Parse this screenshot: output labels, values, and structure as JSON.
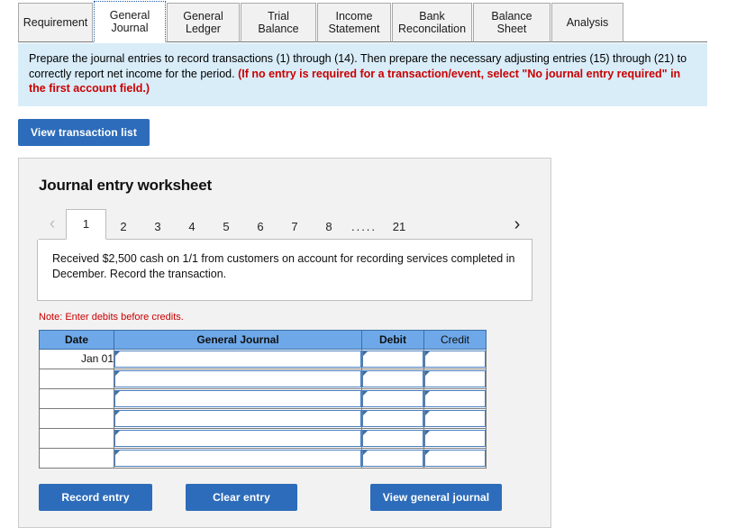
{
  "tabs": [
    {
      "label": "Requirement",
      "active": false
    },
    {
      "label": "General\nJournal",
      "active": true
    },
    {
      "label": "General\nLedger",
      "active": false
    },
    {
      "label": "Trial Balance",
      "active": false
    },
    {
      "label": "Income\nStatement",
      "active": false
    },
    {
      "label": "Bank\nReconcilation",
      "active": false
    },
    {
      "label": "Balance Sheet",
      "active": false
    },
    {
      "label": "Analysis",
      "active": false
    }
  ],
  "instructions": {
    "plain": "Prepare the journal entries to record transactions (1) through (14).  Then prepare the necessary adjusting entries (15) through (21) to correctly report net income for the period. ",
    "warning": "(If no entry is required for a transaction/event, select \"No journal entry required\" in the first account field.)"
  },
  "toolbar": {
    "view_transaction_list": "View transaction list"
  },
  "worksheet": {
    "title": "Journal entry worksheet",
    "pager": {
      "prev_icon": "chevron-left",
      "next_icon": "chevron-right",
      "pages": [
        "1",
        "2",
        "3",
        "4",
        "5",
        "6",
        "7",
        "8"
      ],
      "ellipsis": ".....",
      "last_page": "21",
      "active_page": "1"
    },
    "transaction_text": "Received $2,500 cash on 1/1 from customers on account for recording services completed in December. Record the transaction.",
    "note": "Note: Enter debits before credits.",
    "table": {
      "headers": [
        "Date",
        "General Journal",
        "Debit",
        "Credit"
      ],
      "rows": [
        {
          "date": "Jan 01",
          "account": "",
          "debit": "",
          "credit": ""
        },
        {
          "date": "",
          "account": "",
          "debit": "",
          "credit": ""
        },
        {
          "date": "",
          "account": "",
          "debit": "",
          "credit": ""
        },
        {
          "date": "",
          "account": "",
          "debit": "",
          "credit": ""
        },
        {
          "date": "",
          "account": "",
          "debit": "",
          "credit": ""
        },
        {
          "date": "",
          "account": "",
          "debit": "",
          "credit": ""
        }
      ]
    },
    "buttons": {
      "record_entry": "Record entry",
      "clear_entry": "Clear entry",
      "view_general_journal": "View general journal"
    }
  },
  "colors": {
    "accent_blue": "#2d6cba",
    "table_header_blue": "#6ea8e8",
    "banner_blue": "#d9edf9",
    "warning_red": "#cc0000"
  }
}
